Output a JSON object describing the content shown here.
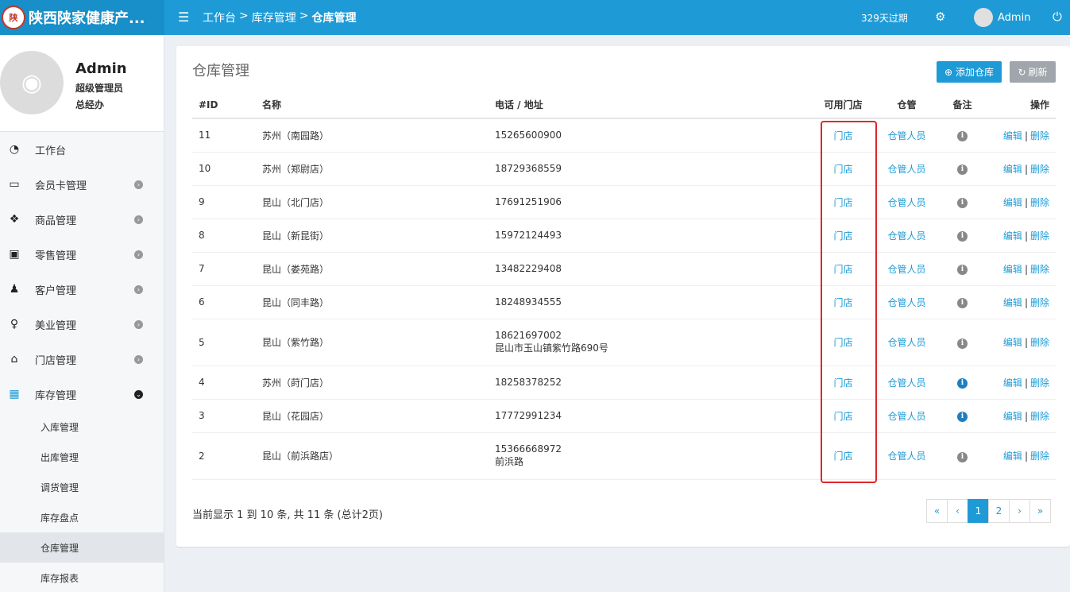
{
  "brand": {
    "logo_text": "陕",
    "title": "陕西陕家健康产..."
  },
  "header": {
    "breadcrumb": [
      "工作台",
      "库存管理",
      "仓库管理"
    ],
    "breadcrumb_sep": ">",
    "expire_text": "329天过期",
    "user_name": "Admin"
  },
  "profile": {
    "name": "Admin",
    "role": "超级管理员",
    "dept": "总经办"
  },
  "sidebar": {
    "items": [
      {
        "label": "工作台",
        "icon": "dashboard-icon"
      },
      {
        "label": "会员卡管理",
        "icon": "credit-card-icon"
      },
      {
        "label": "商品管理",
        "icon": "cubes-icon"
      },
      {
        "label": "零售管理",
        "icon": "money-icon"
      },
      {
        "label": "客户管理",
        "icon": "male-icon"
      },
      {
        "label": "美业管理",
        "icon": "female-icon"
      },
      {
        "label": "门店管理",
        "icon": "home-icon"
      },
      {
        "label": "库存管理",
        "icon": "archive-icon"
      }
    ],
    "subitems": [
      "入库管理",
      "出库管理",
      "调货管理",
      "库存盘点",
      "仓库管理",
      "库存报表"
    ]
  },
  "main": {
    "title": "仓库管理",
    "add_button": "添加仓库",
    "refresh_button": "刷新",
    "columns": [
      "#ID",
      "名称",
      "电话 / 地址",
      "可用门店",
      "仓管",
      "备注",
      "操作"
    ],
    "rows": [
      {
        "id": "11",
        "name": "苏州（南园路）",
        "phone": "15265600900",
        "address": "",
        "store": "门店",
        "keeper": "仓管人员",
        "note_active": false
      },
      {
        "id": "10",
        "name": "苏州（郑尉店）",
        "phone": "18729368559",
        "address": "",
        "store": "门店",
        "keeper": "仓管人员",
        "note_active": false
      },
      {
        "id": "9",
        "name": "昆山（北门店）",
        "phone": "17691251906",
        "address": "",
        "store": "门店",
        "keeper": "仓管人员",
        "note_active": false
      },
      {
        "id": "8",
        "name": "昆山（新昆街）",
        "phone": "15972124493",
        "address": "",
        "store": "门店",
        "keeper": "仓管人员",
        "note_active": false
      },
      {
        "id": "7",
        "name": "昆山（娄苑路）",
        "phone": "13482229408",
        "address": "",
        "store": "门店",
        "keeper": "仓管人员",
        "note_active": false
      },
      {
        "id": "6",
        "name": "昆山（同丰路）",
        "phone": "18248934555",
        "address": "",
        "store": "门店",
        "keeper": "仓管人员",
        "note_active": false
      },
      {
        "id": "5",
        "name": "昆山（紫竹路）",
        "phone": "18621697002",
        "address": "昆山市玉山镇紫竹路690号",
        "store": "门店",
        "keeper": "仓管人员",
        "note_active": false
      },
      {
        "id": "4",
        "name": "苏州（莳门店）",
        "phone": "18258378252",
        "address": "",
        "store": "门店",
        "keeper": "仓管人员",
        "note_active": true
      },
      {
        "id": "3",
        "name": "昆山（花园店）",
        "phone": "17772991234",
        "address": "",
        "store": "门店",
        "keeper": "仓管人员",
        "note_active": true
      },
      {
        "id": "2",
        "name": "昆山（前浜路店）",
        "phone": "15366668972",
        "address": "前浜路",
        "store": "门店",
        "keeper": "仓管人员",
        "note_active": false
      }
    ],
    "edit_label": "编辑",
    "delete_label": "删除",
    "action_sep": "|",
    "note_glyph": "i"
  },
  "pagination": {
    "info": "当前显示 1 到 10 条, 共 11 条 (总计2页)",
    "buttons": [
      "«",
      "‹",
      "1",
      "2",
      "›",
      "»"
    ],
    "current": "1"
  },
  "colors": {
    "accent": "#1e9bd6",
    "highlight": "#e0262a"
  }
}
